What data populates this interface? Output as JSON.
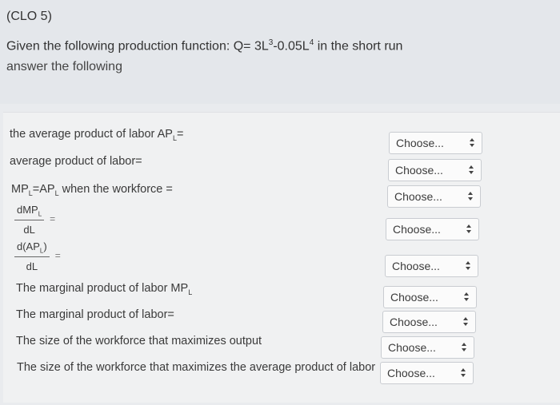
{
  "header": {
    "clo": "(CLO 5)",
    "given_prefix": "Given the following production function: Q= 3L",
    "exp1": "3",
    "given_mid": "-0.05L",
    "exp2": "4",
    "given_suffix": "  in the short run",
    "answer_line": "answer the following"
  },
  "rows": [
    {
      "label_prefix": "the average product of labor AP",
      "label_sub": "L",
      "label_suffix": "=",
      "select": "Choose..."
    },
    {
      "label": "average product of labor=",
      "select": "Choose..."
    },
    {
      "label_prefix": "MP",
      "label_sub": "L",
      "label_mid": "=AP",
      "label_sub2": "L",
      "label_suffix": "  when the workforce =",
      "select": "Choose..."
    },
    {
      "frac_num_prefix": "dMP",
      "frac_num_sub": "L",
      "frac_den": "dL",
      "eq": "=",
      "select": "Choose..."
    },
    {
      "frac_num_prefix": "d(AP",
      "frac_num_sub": "L",
      "frac_num_suffix": ")",
      "frac_den": "dL",
      "eq": "=",
      "select": "Choose..."
    },
    {
      "label_prefix": "The marginal product of labor MP",
      "label_sub": "L",
      "select": "Choose..."
    },
    {
      "label": "The marginal product of labor=",
      "select": "Choose..."
    },
    {
      "label": "The size of the workforce that maximizes output",
      "select": "Choose..."
    },
    {
      "label": "The size of the workforce that maximizes the average product of labor",
      "select": "Choose..."
    }
  ],
  "icons": {
    "select_arrow": "up-down-chevron-icon"
  }
}
